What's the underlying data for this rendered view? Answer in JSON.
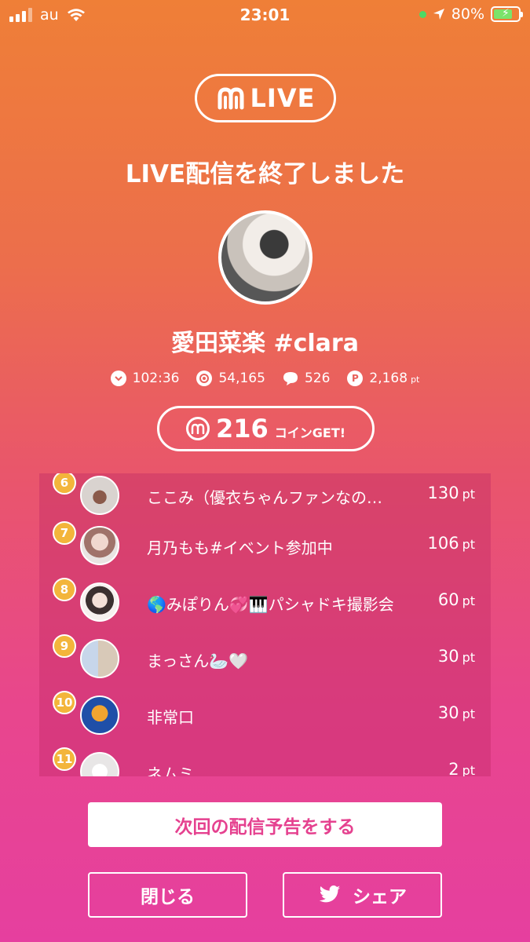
{
  "status_bar": {
    "carrier": "au",
    "time": "23:01",
    "battery": "80%"
  },
  "logo": {
    "text": "LIVE"
  },
  "title": "LIVE配信を終了しました",
  "streamer": {
    "name": "愛田菜楽 #clara"
  },
  "stats": {
    "duration": "102:36",
    "viewers": "54,165",
    "comments": "526",
    "points": "2,168",
    "points_unit": "pt"
  },
  "coins": {
    "amount": "216",
    "label": "コインGET!"
  },
  "ranking": [
    {
      "rank": "6",
      "name": "ここみ（優衣ちゃんファンなの…",
      "points": "130",
      "unit": "pt"
    },
    {
      "rank": "7",
      "name": "月乃もも#イベント参加中",
      "points": "106",
      "unit": "pt"
    },
    {
      "rank": "8",
      "name": "🌎みぽりん💞🎹パシャドキ撮影会",
      "points": "60",
      "unit": "pt"
    },
    {
      "rank": "9",
      "name": "まっさん🦢🤍",
      "points": "30",
      "unit": "pt"
    },
    {
      "rank": "10",
      "name": "非常口",
      "points": "30",
      "unit": "pt"
    },
    {
      "rank": "11",
      "name": "ネムミ",
      "points": "2",
      "unit": "pt"
    }
  ],
  "buttons": {
    "announce": "次回の配信予告をする",
    "close": "閉じる",
    "share": "シェア"
  },
  "colors": {
    "accent": "#e5418f",
    "badge": "#f3b53b"
  }
}
